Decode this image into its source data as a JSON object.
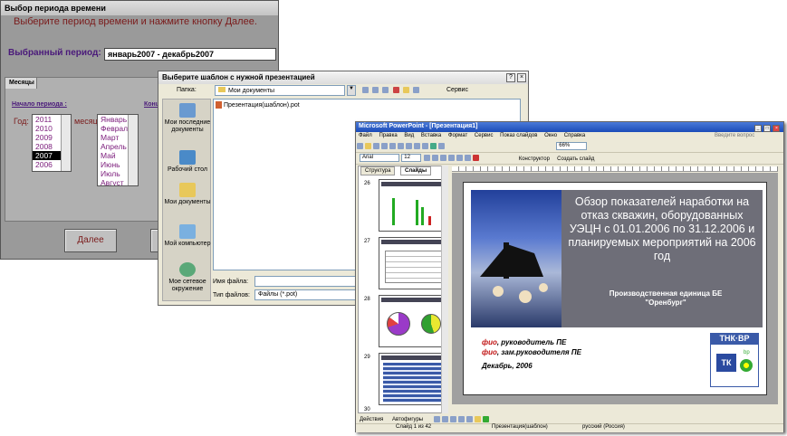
{
  "period_dialog": {
    "title": "Выбор периода времени",
    "instruction": "Выберите период времени и нажмите кнопку Далее.",
    "selected_label": "Выбранный период:",
    "selected_value": "январь2007 - декабрь2007",
    "tab_label": "Месяцы",
    "start_label": "Начало периода :",
    "end_label_partial": "Конц",
    "year_label": "Год:",
    "month_label": "месяц:",
    "years": [
      "2011",
      "2010",
      "2009",
      "2008",
      "2007",
      "2006"
    ],
    "selected_year": "2007",
    "months": [
      "Январь",
      "Февраль",
      "Март",
      "Апрель",
      "Май",
      "Июнь",
      "Июль",
      "Август"
    ],
    "next_button": "Далее"
  },
  "template_dialog": {
    "title": "Выберите шаблон с нужной презентацией",
    "folder_label": "Папка:",
    "folder_value": "Мои документы",
    "service_label": "Сервис",
    "places": [
      {
        "label": "Мои последние документы",
        "icon": "recent-docs-icon"
      },
      {
        "label": "Рабочий стол",
        "icon": "desktop-icon"
      },
      {
        "label": "Мои документы",
        "icon": "my-documents-icon"
      },
      {
        "label": "Мой компьютер",
        "icon": "my-computer-icon"
      },
      {
        "label": "Мое сетевое окружение",
        "icon": "network-icon"
      }
    ],
    "file_item": "Презентация(шаблон).pot",
    "filename_label": "Имя файла:",
    "filetype_label": "Тип файлов:",
    "filetype_value": "Файлы (*.pot)"
  },
  "powerpoint": {
    "title": "Microsoft PowerPoint - [Презентация1]",
    "menu": [
      "Файл",
      "Правка",
      "Вид",
      "Вставка",
      "Формат",
      "Сервис",
      "Показ слайдов",
      "Окно",
      "Справка"
    ],
    "question_box": "Введите вопрос",
    "zoom": "66%",
    "font_name": "Arial",
    "font_size": "12",
    "designer_label": "Конструктор",
    "new_slide_label": "Создать слайд",
    "pane_tabs": [
      "Структура",
      "Слайды"
    ],
    "slide_numbers": [
      "26",
      "27",
      "28",
      "29",
      "30"
    ],
    "slide": {
      "heading": "Обзор показателей наработки на отказ скважин, оборудованных УЭЦН с 01.01.2006 по 31.12.2006 и планируемых мероприятий на  2006 год",
      "unit_line1": "Производственная единица БЕ",
      "unit_line2": "\"Оренбург\"",
      "people": [
        {
          "name": "фио",
          "role": ", руководитель ПЕ"
        },
        {
          "name": "фио",
          "role": ", зам.руководителя ПЕ"
        }
      ],
      "date": "Декабрь, 2006",
      "logo": "ТНК·ВР",
      "logo_small": "bp"
    },
    "drawing_bar": {
      "actions": "Действия",
      "autoshapes": "Автофигуры"
    },
    "status": {
      "slide": "Слайд 1 из 42",
      "template": "Презентация(шаблон)",
      "language": "русский (Россия)"
    }
  }
}
